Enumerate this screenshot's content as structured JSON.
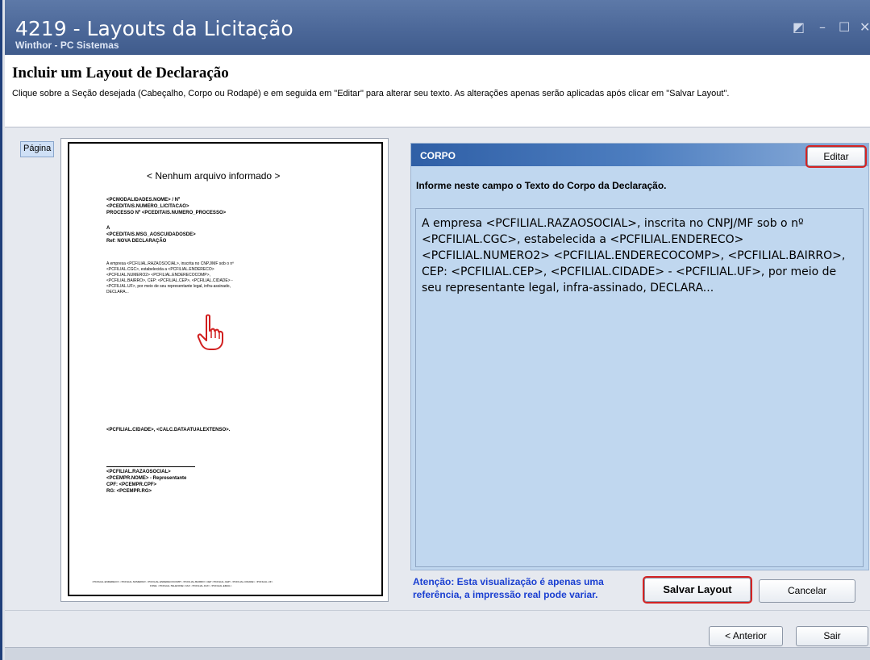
{
  "window": {
    "title": "4219 - Layouts da Licitação",
    "subtitle": "Winthor - PC Sistemas",
    "controls": [
      "restore-icon",
      "minimize-icon",
      "maximize-icon",
      "close-icon"
    ]
  },
  "header": {
    "title": "Incluir um Layout de Declaração",
    "description": "Clique sobre a Seção desejada (Cabeçalho, Corpo ou Rodapé) e em seguida em \"Editar\" para alterar seu texto. As alterações apenas serão aplicadas após clicar em \"Salvar Layout\"."
  },
  "tab": {
    "label": "Página"
  },
  "preview": {
    "no_file": "< Nenhum arquivo informado >",
    "header_lines": [
      "<PCMODALIDADES.NOME> / Nº",
      "<PCEDITAIS.NUMERO_LICITACAO>",
      "PROCESSO Nº <PCEDITAIS.NUMERO_PROCESSO>"
    ],
    "to_lines": [
      "A",
      "<PCEDITAIS.MSG_AOSCUIDADOSDE>",
      "Ref: NOVA DECLARAÇÃO"
    ],
    "body_lines": [
      "   A empresa  <PCFILIAL.RAZAOSOCIAL>, inscrita no CNPJ/MF sob o nº",
      "<PCFILIAL.CGC>, estabelecida a <PCFILIAL.ENDERECO>",
      "<PCFILIAL.NUMERO2> <PCFILIAL.ENDERECOCOMP>,",
      "<PCFILIAL.BAIRRO>, CEP: <PCFILIAL.CEP>, <PCFILIAL.CIDADE> -",
      "<PCFILIAL.UF>, por meio de seu representante legal, infra-assinado,",
      "DECLARA..."
    ],
    "date_line": "<PCFILIAL.CIDADE>, <CALC.DATAATUALEXTENSO>.",
    "signature_lines": [
      "<PCFILIAL.RAZAOSOCIAL>",
      "<PCEMPR.NOME> - Representante",
      "CPF: <PCEMPR.CPF>",
      "RG: <PCEMPR.RG>"
    ],
    "footer_lines": [
      "<PCFILIAL.ENDERECO> <PCFILIAL.NUMERO2> <PCFILIAL.ENDERECOCOMP> <PCFILIAL.BAIRRO> CEP <PCFILIAL.CEP> <PCFILIAL.CIDADE> <PCFILIAL.UF>",
      "FONE: <PCFILIAL.TELEFONE> FAX: <PCFILIAL.FAX> <PCFILIAL.EMAIL>"
    ],
    "pointer_icon": "hand-pointer-icon"
  },
  "section": {
    "name": "CORPO",
    "edit_label": "Editar",
    "info": "Informe neste campo o Texto do Corpo da Declaração.",
    "text": "   A empresa  <PCFILIAL.RAZAOSOCIAL>, inscrita no CNPJ/MF sob o nº <PCFILIAL.CGC>, estabelecida a <PCFILIAL.ENDERECO> <PCFILIAL.NUMERO2> <PCFILIAL.ENDERECOCOMP>, <PCFILIAL.BAIRRO>, CEP: <PCFILIAL.CEP>, <PCFILIAL.CIDADE> - <PCFILIAL.UF>, por meio de seu representante legal, infra-assinado, DECLARA..."
  },
  "attention": "Atenção: Esta visualização é apenas uma referência, a impressão real pode variar.",
  "buttons": {
    "save": "Salvar Layout",
    "cancel": "Cancelar",
    "previous": "< Anterior",
    "exit": "Sair"
  },
  "colors": {
    "title_bar": "#4a6697",
    "section_bar": "#2f5fa6",
    "panel_bg": "#c0d7ef",
    "highlight": "#d42323",
    "attention_text": "#1a3fd1"
  }
}
